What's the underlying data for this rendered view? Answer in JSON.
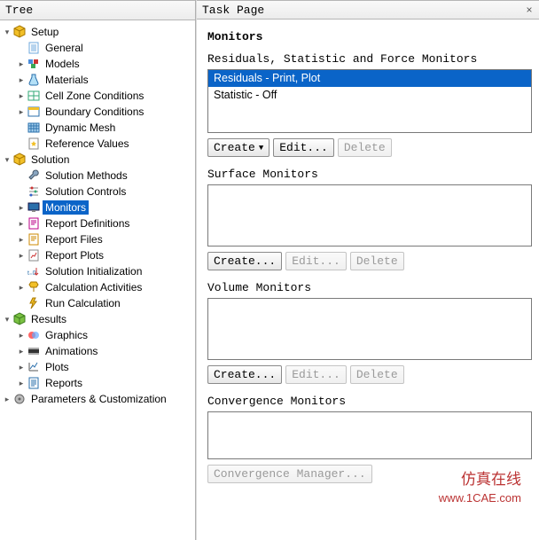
{
  "tree": {
    "title": "Tree",
    "nodes": [
      {
        "level": 0,
        "expand": "open",
        "icon": "cube-yellow",
        "label": "Setup"
      },
      {
        "level": 1,
        "expand": "none",
        "icon": "doc-lines",
        "label": "General"
      },
      {
        "level": 1,
        "expand": "closed",
        "icon": "blocks-blue",
        "label": "Models"
      },
      {
        "level": 1,
        "expand": "closed",
        "icon": "flask",
        "label": "Materials"
      },
      {
        "level": 1,
        "expand": "closed",
        "icon": "cell-zone",
        "label": "Cell Zone Conditions"
      },
      {
        "level": 1,
        "expand": "closed",
        "icon": "boundary",
        "label": "Boundary Conditions"
      },
      {
        "level": 1,
        "expand": "none",
        "icon": "mesh-blue",
        "label": "Dynamic Mesh"
      },
      {
        "level": 1,
        "expand": "none",
        "icon": "doc-star",
        "label": "Reference Values"
      },
      {
        "level": 0,
        "expand": "open",
        "icon": "cube-yellow",
        "label": "Solution"
      },
      {
        "level": 1,
        "expand": "none",
        "icon": "wrench",
        "label": "Solution Methods"
      },
      {
        "level": 1,
        "expand": "none",
        "icon": "sliders",
        "label": "Solution Controls"
      },
      {
        "level": 1,
        "expand": "closed",
        "icon": "monitor",
        "label": "Monitors",
        "selected": true
      },
      {
        "level": 1,
        "expand": "closed",
        "icon": "report-def",
        "label": "Report Definitions"
      },
      {
        "level": 1,
        "expand": "closed",
        "icon": "report-file",
        "label": "Report Files"
      },
      {
        "level": 1,
        "expand": "closed",
        "icon": "report-plot",
        "label": "Report Plots"
      },
      {
        "level": 1,
        "expand": "none",
        "icon": "init",
        "label": "Solution Initialization"
      },
      {
        "level": 1,
        "expand": "closed",
        "icon": "calc-act",
        "label": "Calculation Activities"
      },
      {
        "level": 1,
        "expand": "none",
        "icon": "run",
        "label": "Run Calculation"
      },
      {
        "level": 0,
        "expand": "open",
        "icon": "cube-green",
        "label": "Results"
      },
      {
        "level": 1,
        "expand": "closed",
        "icon": "graphics",
        "label": "Graphics"
      },
      {
        "level": 1,
        "expand": "closed",
        "icon": "anim",
        "label": "Animations"
      },
      {
        "level": 1,
        "expand": "closed",
        "icon": "plots",
        "label": "Plots"
      },
      {
        "level": 1,
        "expand": "closed",
        "icon": "reports",
        "label": "Reports"
      },
      {
        "level": 0,
        "expand": "closed",
        "icon": "params",
        "label": "Parameters & Customization"
      }
    ]
  },
  "task": {
    "title": "Task Page",
    "heading": "Monitors",
    "close": "×",
    "groups": {
      "residuals": {
        "label": "Residuals, Statistic and Force Monitors",
        "items": [
          "Residuals - Print, Plot",
          "Statistic - Off"
        ],
        "selected_index": 0,
        "buttons": {
          "create": "Create",
          "edit": "Edit...",
          "delete": "Delete"
        }
      },
      "surface": {
        "label": "Surface Monitors",
        "items": [],
        "buttons": {
          "create": "Create...",
          "edit": "Edit...",
          "delete": "Delete"
        }
      },
      "volume": {
        "label": "Volume Monitors",
        "items": [],
        "buttons": {
          "create": "Create...",
          "edit": "Edit...",
          "delete": "Delete"
        }
      },
      "convergence": {
        "label": "Convergence Monitors",
        "items": [],
        "buttons": {
          "manager": "Convergence Manager..."
        }
      }
    }
  },
  "watermark": {
    "cn": "仿真在线",
    "url": "www.1CAE.com"
  }
}
